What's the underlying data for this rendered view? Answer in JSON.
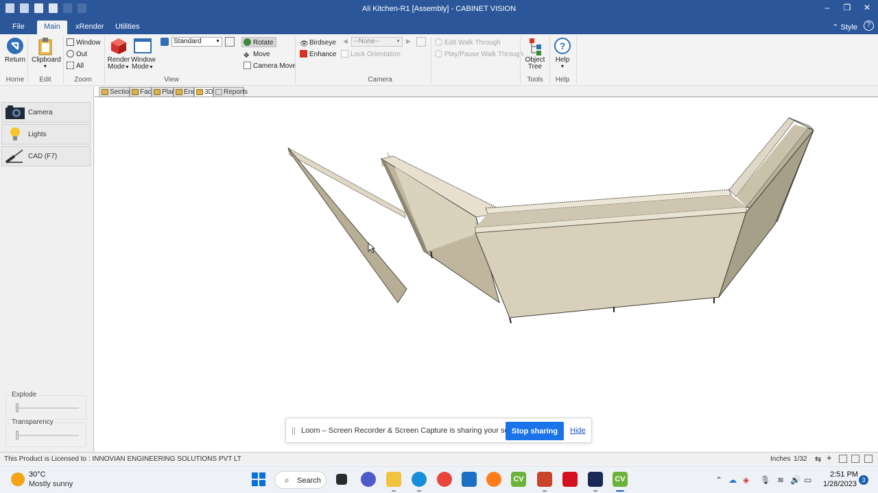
{
  "titlebar": {
    "title": "Ali Kitchen-R1 [Assembly] - CABINET VISION",
    "quick_access_icons": [
      "new-file-icon",
      "open-folder-icon",
      "save-icon",
      "print-icon",
      "undo-icon",
      "redo-icon"
    ],
    "minimize": "–",
    "restore": "❐",
    "close": "✕"
  },
  "ribbon_tabs": {
    "file": "File",
    "main": "Main",
    "xrender": "xRender",
    "utilities": "Utilities",
    "style": "Style",
    "help": "?"
  },
  "ribbon": {
    "home": {
      "return_label": "Return",
      "group": "Home"
    },
    "edit": {
      "clipboard_label": "Clipboard",
      "group": "Edit"
    },
    "zoom": {
      "window": "Window",
      "out": "Out",
      "all": "All",
      "group": "Zoom"
    },
    "view": {
      "render_mode": "Render",
      "render_mode2": "Mode",
      "window_mode": "Window",
      "window_mode2": "Mode",
      "standard_value": "Standard",
      "rotate": "Rotate",
      "move": "Move",
      "camera_move": "Camera Move",
      "group": "View"
    },
    "camera": {
      "birdseye": "Birdseye",
      "enhance": "Enhance",
      "none_select": "--None--",
      "lock_orientation": "Lock Orientation",
      "edit_walk": "Edit Walk Through",
      "play_walk": "Play/Pause Walk Through",
      "group": "Camera"
    },
    "tools": {
      "object_tree": "Object",
      "object_tree2": "Tree",
      "group": "Tools"
    },
    "help": {
      "help_label": "Help",
      "group": "Help"
    }
  },
  "left_panel": {
    "camera": "Camera",
    "lights": "Lights",
    "cad": "CAD (F7)",
    "explode_label": "Explode",
    "transparency_label": "Transparency"
  },
  "view_tabs": [
    "Section",
    "Face",
    "Plan",
    "End",
    "3D",
    "Reports"
  ],
  "loom": {
    "message": "Loom – Screen Recorder & Screen Capture is sharing your screen.",
    "stop": "Stop sharing",
    "hide": "Hide"
  },
  "statusbar": {
    "license": "This Product is Licensed to : INNOVIAN ENGINEERING SOLUTIONS PVT LT",
    "units": "Inches",
    "precision": "1/32"
  },
  "taskbar": {
    "temp": "30°C",
    "weather": "Mostly sunny",
    "search": "Search",
    "time": "2:51 PM",
    "date": "1/28/2023",
    "notifications": "3",
    "cv_label": "CV"
  }
}
